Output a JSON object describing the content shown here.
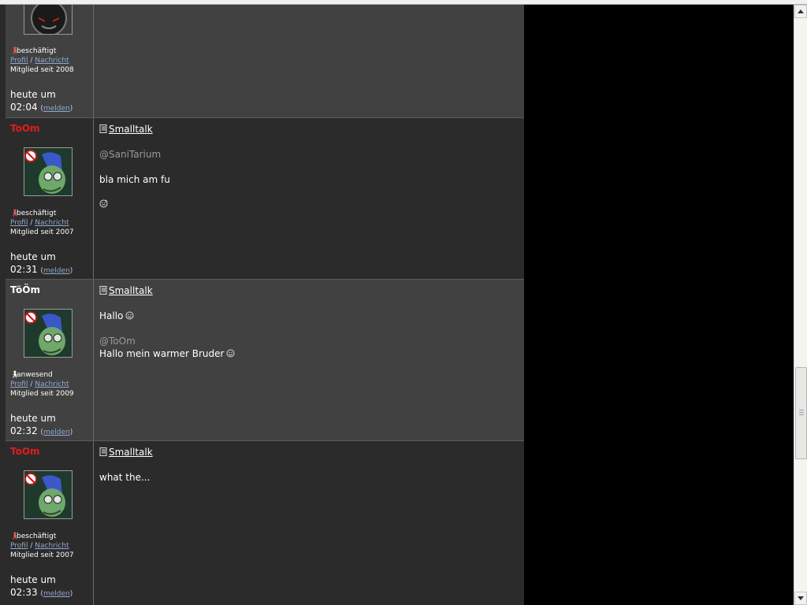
{
  "posts": [
    {
      "username": "",
      "status_icon": "busy-person-icon",
      "status": "beschäftigt",
      "profile_link": "Profil",
      "link_separator": "/",
      "message_link": "Nachricht",
      "member_since": "Mitglied seit 2008",
      "time_line1": "heute um",
      "time_line2": "02:04",
      "report_link": "melden",
      "topic_icon": "document-icon",
      "topic": "",
      "lines": []
    },
    {
      "username": "ToOm",
      "status_icon": "busy-person-icon",
      "status": "beschäftigt",
      "profile_link": "Profil",
      "link_separator": "/",
      "message_link": "Nachricht",
      "member_since": "Mitglied seit 2007",
      "time_line1": "heute um",
      "time_line2": "02:31",
      "report_link": "melden",
      "topic_icon": "document-icon",
      "topic": "Smalltalk",
      "lines": [
        "@SaniTarium",
        "bla mich am fu",
        ""
      ]
    },
    {
      "username": "TöÖm",
      "status_icon": "present-person-icon",
      "status": "anwesend",
      "profile_link": "Profil",
      "link_separator": "/",
      "message_link": "Nachricht",
      "member_since": "Mitglied seit 2009",
      "time_line1": "heute um",
      "time_line2": "02:32",
      "report_link": "melden",
      "topic_icon": "document-icon",
      "topic": "Smalltalk",
      "lines": [
        "Hallo",
        "@ToOm",
        "Hallo mein warmer Bruder"
      ]
    },
    {
      "username": "ToOm",
      "status_icon": "busy-person-icon",
      "status": "beschäftigt",
      "profile_link": "Profil",
      "link_separator": "/",
      "message_link": "Nachricht",
      "member_since": "Mitglied seit 2007",
      "time_line1": "heute um",
      "time_line2": "02:33",
      "report_link": "melden",
      "topic_icon": "document-icon",
      "topic": "Smalltalk",
      "lines": [
        "what the..."
      ]
    }
  ],
  "colors": {
    "username_red": "#e41c1c",
    "username_white": "#ffffff",
    "link_blue": "#8fa9d0",
    "post_light": "#414141",
    "post_dark": "#2b2b2b"
  },
  "scrollbar": {
    "position_fraction": 0.76
  }
}
